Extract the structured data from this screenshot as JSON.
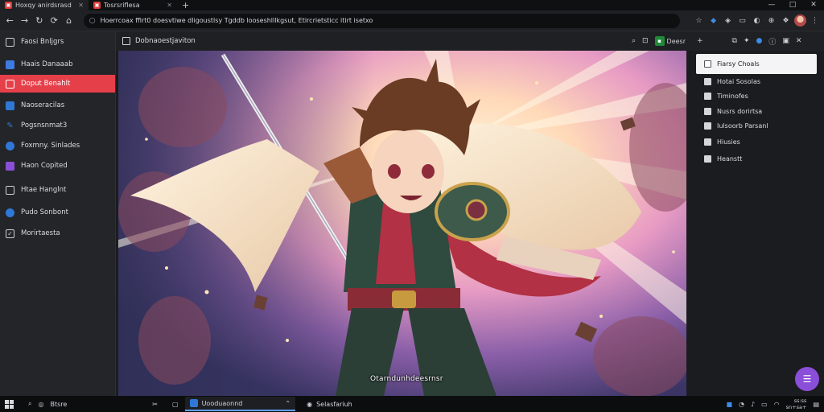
{
  "tabs": [
    {
      "title": "Hoxqy anirdsrasd",
      "active": true
    },
    {
      "title": "Tosrsriflesa",
      "active": false
    }
  ],
  "new_tab_label": "+",
  "window_controls": [
    "—",
    "□",
    "✕"
  ],
  "omnibox": {
    "url": "Hoerrcoax ffirt0 doesvtiwe dligoustlsy Tgddb looseshlllkgsut, Etircrietsticc itirt isetxo"
  },
  "sidebar": {
    "items": [
      {
        "label": "Faosi Bnljgrs",
        "icon": "list-icon",
        "color": "#cfcfd4"
      },
      {
        "label": "Haais Danaaab",
        "icon": "photo-icon",
        "color": "#3d7be0"
      },
      {
        "label": "Doput Benahlt",
        "icon": "calendar-icon",
        "color": "#ffffff",
        "active": true
      },
      {
        "label": "Naoseracilas",
        "icon": "book-icon",
        "color": "#2f78d6"
      },
      {
        "label": "Pogsnsnmat3",
        "icon": "pen-icon",
        "color": "#2f78d6"
      },
      {
        "label": "Foxmny. Sinlades",
        "icon": "edge-icon",
        "color": "#2f78d6"
      },
      {
        "label": "Haon Copited",
        "icon": "purple-app-icon",
        "color": "#8a4fd8"
      },
      {
        "label": "Htae Hanglnt",
        "icon": "note-icon",
        "color": "#cfcfd4"
      },
      {
        "label": "Pudo Sonbont",
        "icon": "edge-icon",
        "color": "#2f78d6"
      },
      {
        "label": "Morirtaesta",
        "icon": "check-icon",
        "color": "#cfcfd4"
      }
    ]
  },
  "main": {
    "title": "Dobnaoestjaviton",
    "share_label": "Deesr",
    "watermark": "Otarndunhdeesrnsr"
  },
  "right_panel": {
    "items": [
      {
        "label": "Fiarsy Choals",
        "selected": true
      },
      {
        "label": "Hotai Sosolas"
      },
      {
        "label": "Timinofes"
      },
      {
        "label": "Nusrs dorirtsa"
      },
      {
        "label": "Iulsoorb Parsanl"
      },
      {
        "label": "Hiusies"
      },
      {
        "label": "Heanstt"
      }
    ]
  },
  "taskbar": {
    "search_label": "Btsre",
    "apps": [
      {
        "label": "Uooduaonnd",
        "active": true,
        "color": "#2f78d6"
      },
      {
        "label": "Selasfariuh",
        "active": false,
        "color": "#cfcfd4"
      }
    ],
    "clock_time": "ss:ss",
    "clock_date": "sn+sa+"
  }
}
